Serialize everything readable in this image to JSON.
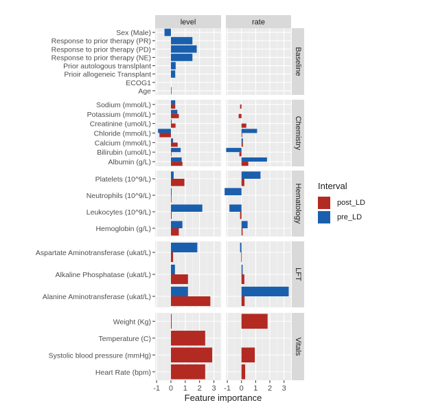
{
  "chart_data": {
    "type": "bar",
    "orientation": "horizontal",
    "title": "",
    "xlabel": "Feature importance",
    "ylabel": "",
    "xlim": [
      -1.1,
      3.5
    ],
    "x_ticks": [
      -1,
      0,
      1,
      2,
      3
    ],
    "grid": true,
    "legend": {
      "title": "Interval",
      "placement": "right",
      "entries": [
        {
          "name": "post_LD",
          "color": "#B22A22"
        },
        {
          "name": "pre_LD",
          "color": "#1A5FAD"
        }
      ]
    },
    "column_facets": [
      "level",
      "rate"
    ],
    "row_facets": [
      {
        "name": "Baseline",
        "features": [
          "Sex (Male)",
          "Response to prior therapy (PR)",
          "Response to prior therapy (PD)",
          "Response to prior therapy (NE)",
          "Prior autologous translplant",
          "Prioir allogeneic Transplant",
          "ECOG1",
          "Age"
        ],
        "paired": false,
        "level": {
          "pre_LD": [
            -0.45,
            1.5,
            1.8,
            1.5,
            0.33,
            0.3,
            0.0,
            0.02
          ]
        },
        "rate": {
          "pre_LD": [
            0,
            0,
            0,
            0,
            0,
            0,
            0,
            0
          ]
        }
      },
      {
        "name": "Chemistry",
        "features": [
          "Sodium (mmol/L)",
          "Potassium (mmol/L)",
          "Creatinine (umol/L)",
          "Chloride (mmol/L)",
          "Calcium (mmol/L)",
          "Bilirubin (umol/L)",
          "Albumin (g/L)"
        ],
        "paired": true,
        "level": {
          "pre_LD": [
            0.3,
            0.45,
            0.05,
            -0.9,
            0.15,
            0.68,
            0.75
          ],
          "post_LD": [
            0.3,
            0.55,
            0.32,
            -0.8,
            0.47,
            0.03,
            0.8
          ]
        },
        "rate": {
          "pre_LD": [
            0.0,
            0.0,
            0.0,
            1.1,
            0.1,
            -1.08,
            1.8
          ],
          "post_LD": [
            -0.1,
            -0.2,
            0.34,
            0.05,
            0.1,
            -0.15,
            0.48
          ]
        }
      },
      {
        "name": "Hematology",
        "features": [
          "Platelets (10^9/L)",
          "Neutrophils (10^9/L)",
          "Leukocytes (10^9/L)",
          "Hemoglobin (g/L)"
        ],
        "paired": true,
        "level": {
          "pre_LD": [
            0.19,
            0.05,
            2.19,
            0.8
          ],
          "post_LD": [
            0.94,
            0.03,
            0.05,
            0.55
          ]
        },
        "rate": {
          "pre_LD": [
            1.34,
            -1.19,
            -0.85,
            0.43
          ],
          "post_LD": [
            0.2,
            0.0,
            -0.1,
            0.08
          ]
        }
      },
      {
        "name": "LFT",
        "features": [
          "Aspartate Aminotransferase (ukat/L)",
          "Alkaline Phosphatase (ukat/L)",
          "Alanine Aminotransferase (ukat/L)"
        ],
        "paired": true,
        "level": {
          "pre_LD": [
            1.84,
            0.28,
            1.19
          ],
          "post_LD": [
            0.15,
            1.19,
            2.75
          ]
        },
        "rate": {
          "pre_LD": [
            -0.1,
            0.08,
            3.33
          ],
          "post_LD": [
            -0.02,
            0.2,
            0.22
          ]
        }
      },
      {
        "name": "Vitals",
        "features": [
          "Weight (Kg)",
          "Temperature (C)",
          "Systolic blood pressure (mmHg)",
          "Heart Rate (bpm)"
        ],
        "paired": false,
        "level": {
          "post_LD": [
            0.05,
            2.39,
            2.88,
            2.39
          ]
        },
        "rate": {
          "post_LD": [
            1.84,
            0.0,
            0.94,
            0.26
          ]
        }
      }
    ]
  }
}
